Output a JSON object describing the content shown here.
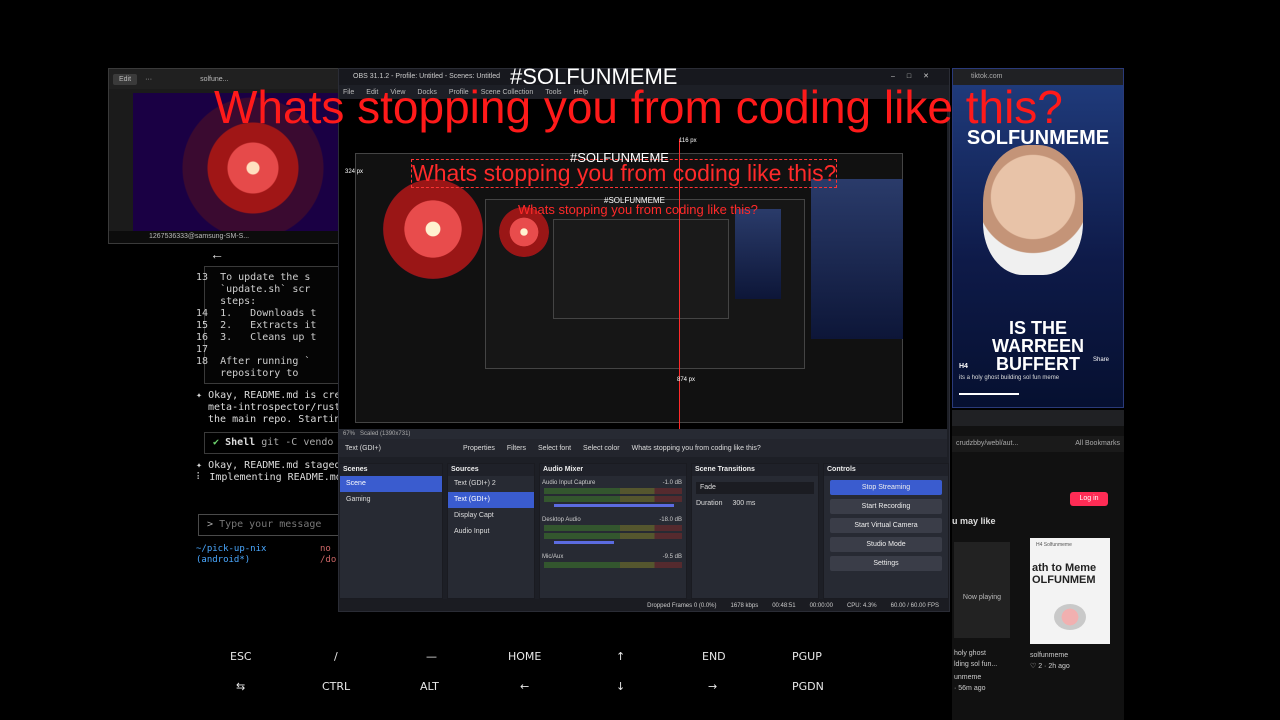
{
  "overlay": {
    "hashtag": "#SOLFUNMEME",
    "headline": "Whats stopping you from coding like this?"
  },
  "top_left_window": {
    "edit_label": "Edit",
    "title": "solfune...",
    "status_text": "1267536333@samsung-SM-S..."
  },
  "terminal": {
    "lines": [
      "13  To update the s",
      "    `update.sh` scr",
      "    steps:",
      "14  1.   Downloads t",
      "15  2.   Extracts it",
      "16  3.   Cleans up t",
      "17",
      "18  After running `",
      "    repository to"
    ],
    "msg1_a": "Okay, README.md is cre",
    "msg1_b": "meta-introspector/rust",
    "msg1_c": "the main repo. Startin",
    "shell_label": "Shell",
    "shell_cmd": "git -C vendo",
    "msg2_a": "Okay, README.md staged",
    "msg2_b": "Implementing README.md",
    "input_placeholder": "Type your message",
    "cwd": "~/pick-up-nix",
    "branch": "(android*)",
    "col2a": "no",
    "col2b": "/do"
  },
  "keyboard": {
    "row1": [
      "ESC",
      "/",
      "—",
      "HOME",
      "↑",
      "END",
      "PGUP"
    ],
    "row2": [
      "⇆",
      "CTRL",
      "ALT",
      "←",
      "↓",
      "→",
      "PGDN"
    ]
  },
  "obs": {
    "title": "OBS 31.1.2 - Profile: Untitled - Scenes: Untitled",
    "menu": [
      "File",
      "Edit",
      "View",
      "Docks",
      "Profile",
      "Scene Collection",
      "Tools",
      "Help"
    ],
    "preview_status_left": "67%",
    "preview_status_mid": "Scaled (1390x731)",
    "measure_top": "116 px",
    "measure_left": "324 px",
    "measure_bottom": "874 px",
    "toolbar": {
      "source": "Text (GDI+)",
      "properties": "Properties",
      "filters": "Filters",
      "select_font": "Select font",
      "select_color": "Select color",
      "text_value": "Whats stopping you from coding like this?"
    },
    "scenes": {
      "title": "Scenes",
      "items": [
        "Scene",
        "Gaming"
      ]
    },
    "sources": {
      "title": "Sources",
      "items": [
        "Text (GDI+) 2",
        "Text (GDI+)",
        "Display Capt",
        "Audio Input"
      ]
    },
    "mixer": {
      "title": "Audio Mixer",
      "channels": [
        {
          "name": "Audio Input Capture",
          "db": "-1.0 dB"
        },
        {
          "name": "Desktop Audio",
          "db": "-18.0 dB"
        },
        {
          "name": "Mic/Aux",
          "db": "-9.5 dB"
        }
      ]
    },
    "transitions": {
      "title": "Scene Transitions",
      "type": "Fade",
      "duration_label": "Duration",
      "duration_value": "300 ms"
    },
    "controls": {
      "title": "Controls",
      "buttons": [
        "Stop Streaming",
        "Start Recording",
        "Start Virtual Camera",
        "Studio Mode",
        "Settings"
      ]
    },
    "status": {
      "dropped": "Dropped Frames 0 (0.0%)",
      "kbps": "1678 kbps",
      "stream_time": "00:48:51",
      "rec_time": "00:00:00",
      "cpu": "CPU: 4.3%",
      "fps": "60.00 / 60.00 FPS"
    }
  },
  "tiktok": {
    "url": "tiktok.com",
    "brand": "SOLFUNMEME",
    "caption_line1": "IS  THE",
    "caption_line2": "WARREEN BUFFERT",
    "author": "H4",
    "desc": "its a holy ghost building sol fun meme",
    "share": "Share"
  },
  "browser_lower": {
    "url": "crudzbby/webl/aut...",
    "bookmarks": "All Bookmarks",
    "login": "Log in",
    "may_like": "u may like",
    "now_playing": "Now playing",
    "card_title": "ath to Meme OLFUNMEM",
    "card_tag": "H4 Solfunmeme",
    "item1": "holy ghost",
    "item2": "lding sol fun...",
    "item3": "unmeme",
    "item4": "· 56m ago",
    "author": "solfunmeme",
    "meta": "♡ 2 · 2h ago"
  }
}
